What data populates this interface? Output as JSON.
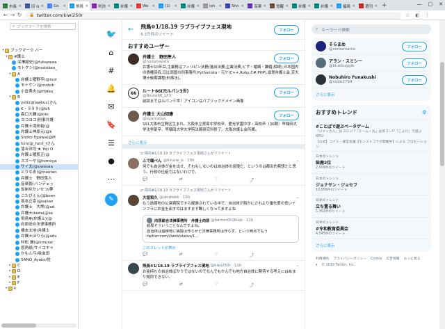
{
  "browser": {
    "tabs": [
      {
        "label": "市長",
        "color": "#2e7d32"
      },
      {
        "label": "旧 G",
        "color": "#3b5998"
      },
      {
        "label": "Go",
        "color": "#4285f4"
      },
      {
        "label": "飛鳥",
        "color": "#1da1f2",
        "active": true
      },
      {
        "label": "判決",
        "color": "#8e24aa"
      },
      {
        "label": "弁護",
        "color": "#00897b"
      },
      {
        "label": "We",
        "color": "#e53935"
      },
      {
        "label": "(1)",
        "color": "#1da1f2"
      },
      {
        "label": "弁護",
        "color": "#00897b"
      },
      {
        "label": "iph",
        "color": "#999999"
      },
      {
        "label": "Sho",
        "color": "#3949ab"
      },
      {
        "label": "深澤",
        "color": "#5e35b1"
      },
      {
        "label": "覚醒",
        "color": "#6d4c41"
      },
      {
        "label": "弁護",
        "color": "#00897b"
      },
      {
        "label": "弁護",
        "color": "#00897b"
      },
      {
        "label": "福島",
        "color": "#1da1f2"
      },
      {
        "label": "週刊",
        "color": "#c62828"
      }
    ],
    "new_tab": "+",
    "window_controls": [
      "—",
      "□",
      "✕"
    ],
    "url": "twitter.com/kiwi250r",
    "nav_back": "←",
    "nav_forward": "→",
    "nav_reload": "↻"
  },
  "bookmarks": {
    "search_placeholder": "ブックマークを検索",
    "items": [
      {
        "indent": 0,
        "toggle": "▾",
        "type": "folder",
        "label": "ブックマーク バー"
      },
      {
        "indent": 1,
        "toggle": "▾",
        "type": "folder",
        "label": "#護士"
      },
      {
        "indent": 2,
        "toggle": "",
        "type": "twitter",
        "label": "深澤諭史(@fukazawa"
      },
      {
        "indent": 2,
        "toggle": "",
        "type": "twitter",
        "label": "モトケン(@motoken_"
      },
      {
        "indent": 2,
        "toggle": "▾",
        "type": "folder",
        "label": "A"
      },
      {
        "indent": 3,
        "toggle": "",
        "type": "twitter",
        "label": "弁護士猪野亨(@inol"
      },
      {
        "indent": 3,
        "toggle": "",
        "type": "twitter",
        "label": "モトケン(@motok"
      },
      {
        "indent": 3,
        "toggle": "",
        "type": "twitter",
        "label": "小倉秀夫(@Hideo"
      },
      {
        "indent": 2,
        "toggle": "▾",
        "type": "folder",
        "label": "B"
      },
      {
        "indent": 3,
        "toggle": "",
        "type": "twitter",
        "label": "ystk(@lawkus)さん"
      },
      {
        "indent": 3,
        "toggle": "",
        "type": "twitter",
        "label": "K・９９９(@kik"
      },
      {
        "indent": 3,
        "toggle": "",
        "type": "twitter",
        "label": "森口大輔(@kiki"
      },
      {
        "indent": 3,
        "toggle": "",
        "type": "twitter",
        "label": "ヨコヨコ(刑事弁護"
      },
      {
        "indent": 3,
        "toggle": "",
        "type": "twitter",
        "label": "弁護士滝田裕(@"
      },
      {
        "indent": 3,
        "toggle": "",
        "type": "twitter",
        "label": "弁護士神原元(@k"
      },
      {
        "indent": 3,
        "toggle": "",
        "type": "twitter",
        "label": "Shoko Egawa(@M"
      },
      {
        "indent": 3,
        "toggle": "",
        "type": "twitter",
        "label": "hzn(@_hznf_)さん"
      },
      {
        "indent": 3,
        "toggle": "",
        "type": "twitter",
        "label": "落合洋司 ★ Yoji O"
      },
      {
        "indent": 3,
        "toggle": "",
        "type": "twitter",
        "label": "弁護士猪股正(@"
      },
      {
        "indent": 3,
        "toggle": "",
        "type": "twitter",
        "label": "スズ〜ヤ(@tomoya"
      },
      {
        "indent": 3,
        "toggle": "",
        "type": "twitter",
        "label": "サイ太(@uwasaa",
        "selected": true
      },
      {
        "indent": 3,
        "toggle": "",
        "type": "twitter",
        "label": "とりな氷(@maotan"
      },
      {
        "indent": 3,
        "toggle": "",
        "type": "twitter",
        "label": "弁護士　野田隼人"
      },
      {
        "indent": 3,
        "toggle": "",
        "type": "twitter",
        "label": "音楽製(バンデェッ"
      },
      {
        "indent": 3,
        "toggle": "",
        "type": "twitter",
        "label": "仮制ゆかいせつ/夢"
      },
      {
        "indent": 3,
        "toggle": "",
        "type": "twitter",
        "label": "こたびぇん(@boen"
      },
      {
        "indent": 3,
        "toggle": "",
        "type": "twitter",
        "label": "坂本正幸(@sakan"
      },
      {
        "indent": 3,
        "toggle": "",
        "type": "twitter",
        "label": "弁護士　大熊(@ad"
      },
      {
        "indent": 3,
        "toggle": "",
        "type": "twitter",
        "label": "弁護士ikeda(@ke"
      },
      {
        "indent": 3,
        "toggle": "",
        "type": "twitter",
        "label": "飛鳥❁(弁護士)(@"
      },
      {
        "indent": 3,
        "toggle": "",
        "type": "twitter",
        "label": "向原総合法律事務所"
      },
      {
        "indent": 3,
        "toggle": "",
        "type": "twitter",
        "label": "橋本太地(弁護士"
      },
      {
        "indent": 3,
        "toggle": "",
        "type": "twitter",
        "label": "弁護士ほりら(@adv"
      },
      {
        "indent": 3,
        "toggle": "",
        "type": "twitter",
        "label": "村松 謙(@kmurar"
      },
      {
        "indent": 3,
        "toggle": "",
        "type": "twitter",
        "label": "感熱紙(サイコキャ"
      },
      {
        "indent": 3,
        "toggle": "",
        "type": "twitter",
        "label": "かもん弓(吸血田"
      },
      {
        "indent": 3,
        "toggle": "",
        "type": "twitter",
        "label": "SANO_Ayako/佐"
      },
      {
        "indent": 2,
        "toggle": "▸",
        "type": "folder",
        "label": "C"
      },
      {
        "indent": 2,
        "toggle": "▸",
        "type": "folder",
        "label": "D"
      },
      {
        "indent": 2,
        "toggle": "▸",
        "type": "folder",
        "label": "E"
      },
      {
        "indent": 2,
        "toggle": "▸",
        "type": "folder",
        "label": "F"
      },
      {
        "indent": 1,
        "toggle": "▸",
        "type": "folder",
        "label": "k"
      }
    ]
  },
  "twitter_nav": {
    "icons": [
      "bird-icon",
      "home-icon",
      "explore-icon",
      "notifications-icon",
      "messages-icon",
      "bookmarks-icon",
      "lists-icon",
      "profile-icon",
      "more-icon"
    ],
    "glyphs": [
      "🐦",
      "⌂",
      "#",
      "🔔",
      "✉",
      "🔖",
      "☰",
      "●",
      "⋯"
    ],
    "tweet_glyph": "✎"
  },
  "profile_header": {
    "back": "←",
    "name": "飛鳥❁1/18.19 ラブライブフェス現地",
    "count": "6.3万件のツイート",
    "follow": "フォロー"
  },
  "recommended": {
    "title": "おすすめユーザー",
    "users": [
      {
        "name": "弁護士　野田隼人",
        "handle": "@nodahayato",
        "bio": "弁護士10年目,主業務はフィリピン法務(進出法務,企業法務,ビザ・婚姻・離婚,相続),日本国内の債権回収,日比両国の刑事事件,Pythonista・元ケ(C++,Ruby,C#,PHP),滋賀弁護士会,京大博士後期課程(刑事法)。",
        "avatar_color": "#3e2d26",
        "follow": "フォロー"
      },
      {
        "name": "ルート66(元ルパン3世)",
        "handle": "@Route66_LP3",
        "bio": "前回まではルパン三世！アイコンはパブリックドメイン画像",
        "avatar_color": "#ffffff",
        "avatar_text": "66",
        "follow": "フォロー"
      },
      {
        "name": "弁護士 大山知康",
        "handle": "@oyamalaw",
        "bio": "SS1大阪市生野区生まれ。大阪市立貿易中学校卒、愛光学園中学・高校卒（36期）早稲田大学法学部卒、早稲田大学大学院法務研究科修了。大阪弁護士会所属。",
        "avatar_color": "#6d5a4a",
        "follow": "フォロー"
      }
    ],
    "more": "さらに表示"
  },
  "tweets": [
    {
      "context": "飛鳥❁1/18.19 ラブライブフェス現地さんがリツイート",
      "name": "ふで聴ぺん",
      "handle": "@hirune_b · 10h",
      "text": "何でも自治体が金を出せ、それもしないのは自治体の怠慢だ、というのは都合的発想だと思う。行政の仕組ではないわけで。",
      "avatar_color": "#8d6e63",
      "counts": [
        "",
        "",
        "",
        ""
      ]
    },
    {
      "context": "飛鳥❁1/18.19 ラブライブフェス現地さんがリツイート",
      "name": "大窪和久",
      "handle": "@okubokk · 16h",
      "text": "もう過疎地の公営病院ですら経過されている中で、自治体が割かにされより優先度の低いインフラにお金を出すのはますます難しくなってますよね",
      "avatar_color": "#5a4636",
      "quote": {
        "name": "向原総合法律事務所　弁護士向原",
        "handle": "@harrier0516osk · 11h",
        "text": "結局そういうことなんですよね。\n自治体は過疎地に病院は作らせど法律事務所は作らず、という時点でもう\ntwitter.com/i/web/status/1...",
        "link": "このスレッドを表示"
      }
    },
    {
      "context": "",
      "name": "飛鳥❁1/18.19 ラブライブフェス現地",
      "handle": "@kiwi250r · 11h",
      "text": "お金持ちの自治体ばかりではないのでなんでもかんでも地方自治体に期待する考えにはあまり賛同できない。",
      "avatar_color": "#37474f"
    }
  ],
  "right_col": {
    "search_placeholder": "キーワード検索",
    "suggested": [
      {
        "name": "そらまめ",
        "handle": "@sorbamame",
        "avatar_color": "#1a237e",
        "follow": "フォロー"
      },
      {
        "name": "アラン・スミシー",
        "handle": "@bluebuggle",
        "avatar_color": "#546e7a",
        "follow": "フォロー"
      },
      {
        "name": "Nobuhiro Funakushi",
        "handle": "@nobu2794",
        "avatar_color": "#263238",
        "follow": "フォロー"
      }
    ],
    "suggested_more": "さらに表示",
    "trends_title": "おすすめトレンド",
    "trends": [
      {
        "label": "",
        "name": "#ことばで遊ぶベータゲーム",
        "desc": "「ジャッカル」はコロン!?「チーム・丸」は何コン!?「こよけ」で遊ぶRPG!",
        "promo": "【公式】コナミ・運営会議【モンストコラボ開催中】による プロモーション"
      },
      {
        "label": "日本のトレンド",
        "name": "柴鹿2位",
        "desc": "2,609件のツイート",
        "promo": ""
      },
      {
        "label": "日本のトレンド",
        "name": "ジョナサン・ジョセフ",
        "desc": "10,656件のツイート",
        "promo": ""
      },
      {
        "label": "日本のトレンド",
        "name": "立ち置る舞い",
        "desc": "5,352件のツイート",
        "promo": ""
      },
      {
        "label": "日本のトレンド",
        "name": "#令和教育委員会",
        "desc": "4,545件のツイート",
        "promo": ""
      }
    ],
    "trends_more": "さらに表示",
    "footer": [
      "利用規約",
      "プライバシーポリシー",
      "Cookie",
      "広告情報",
      "もっと見る ▾",
      "© 2019 Twitter, Inc."
    ]
  }
}
